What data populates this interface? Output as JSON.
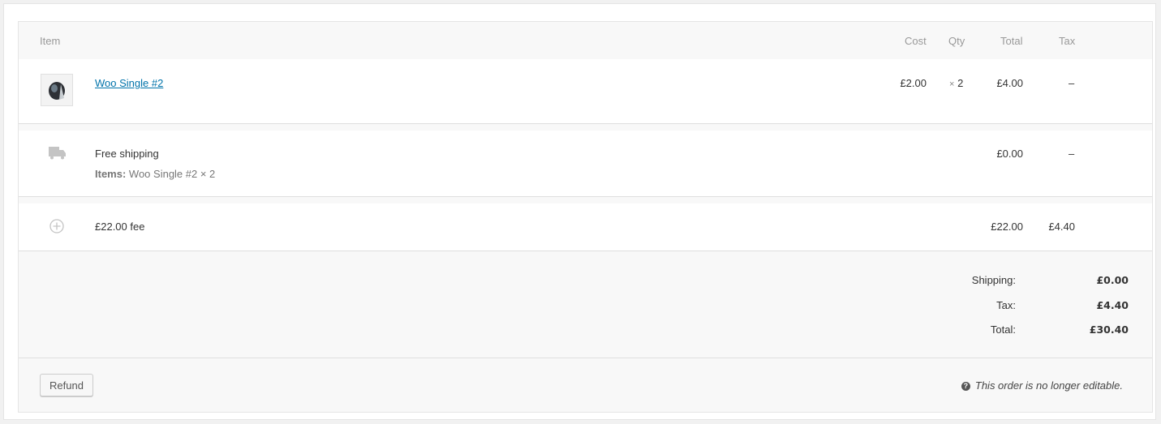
{
  "columns": {
    "item": "Item",
    "cost": "Cost",
    "qty": "Qty",
    "total": "Total",
    "tax": "Tax"
  },
  "line_items": [
    {
      "name": "Woo Single #2",
      "cost": "£2.00",
      "qty_prefix": "×",
      "qty": "2",
      "total": "£4.00",
      "tax": "–"
    }
  ],
  "shipping": {
    "method": "Free shipping",
    "items_label": "Items:",
    "items_value": "Woo Single #2 × 2",
    "total": "£0.00",
    "tax": "–"
  },
  "fee": {
    "name": "£22.00 fee",
    "total": "£22.00",
    "tax": "£4.40"
  },
  "totals": [
    {
      "label": "Shipping:",
      "value": "£0.00"
    },
    {
      "label": "Tax:",
      "value": "£4.40"
    },
    {
      "label": "Total:",
      "value": "£30.40"
    }
  ],
  "actions": {
    "refund_label": "Refund",
    "help_glyph": "?",
    "note": "This order is no longer editable."
  },
  "icons": {
    "product": "product-thumbnail-icon",
    "shipping": "truck-icon",
    "fee": "plus-circle-icon"
  },
  "colors": {
    "link": "#0073aa",
    "panel_bg": "#f8f8f8"
  }
}
